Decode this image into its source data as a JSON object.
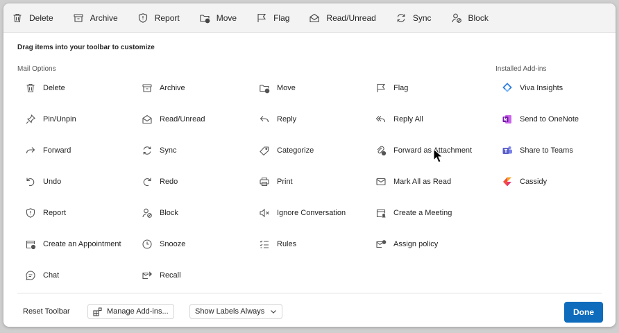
{
  "toolbar": [
    {
      "label": "Delete",
      "icon": "trash-icon"
    },
    {
      "label": "Archive",
      "icon": "archive-icon"
    },
    {
      "label": "Report",
      "icon": "shield-icon"
    },
    {
      "label": "Move",
      "icon": "folder-move-icon"
    },
    {
      "label": "Flag",
      "icon": "flag-icon"
    },
    {
      "label": "Read/Unread",
      "icon": "envelope-open-icon"
    },
    {
      "label": "Sync",
      "icon": "sync-icon"
    },
    {
      "label": "Block",
      "icon": "block-person-icon"
    }
  ],
  "hint": "Drag items into your toolbar to customize",
  "sections": {
    "mail_options": "Mail Options",
    "installed_addins": "Installed Add-ins"
  },
  "mail_options": [
    [
      "Delete",
      "Archive",
      "Move",
      "Flag"
    ],
    [
      "Pin/Unpin",
      "Read/Unread",
      "Reply",
      "Reply All"
    ],
    [
      "Forward",
      "Sync",
      "Categorize",
      "Forward as Attachment"
    ],
    [
      "Undo",
      "Redo",
      "Print",
      "Mark All as Read"
    ],
    [
      "Report",
      "Block",
      "Ignore Conversation",
      "Create a Meeting"
    ],
    [
      "Create an Appointment",
      "Snooze",
      "Rules",
      "Assign policy"
    ],
    [
      "Chat",
      "Recall"
    ]
  ],
  "addins": [
    "Viva Insights",
    "Send to OneNote",
    "Share to Teams",
    "Cassidy"
  ],
  "footer": {
    "reset": "Reset Toolbar",
    "manage": "Manage Add-ins...",
    "labels": "Show Labels Always",
    "done": "Done"
  },
  "colors": {
    "accent": "#0f6cbd",
    "onenote": "#7719aa",
    "teams": "#5b5fc7",
    "viva": "#2f7ee0"
  }
}
